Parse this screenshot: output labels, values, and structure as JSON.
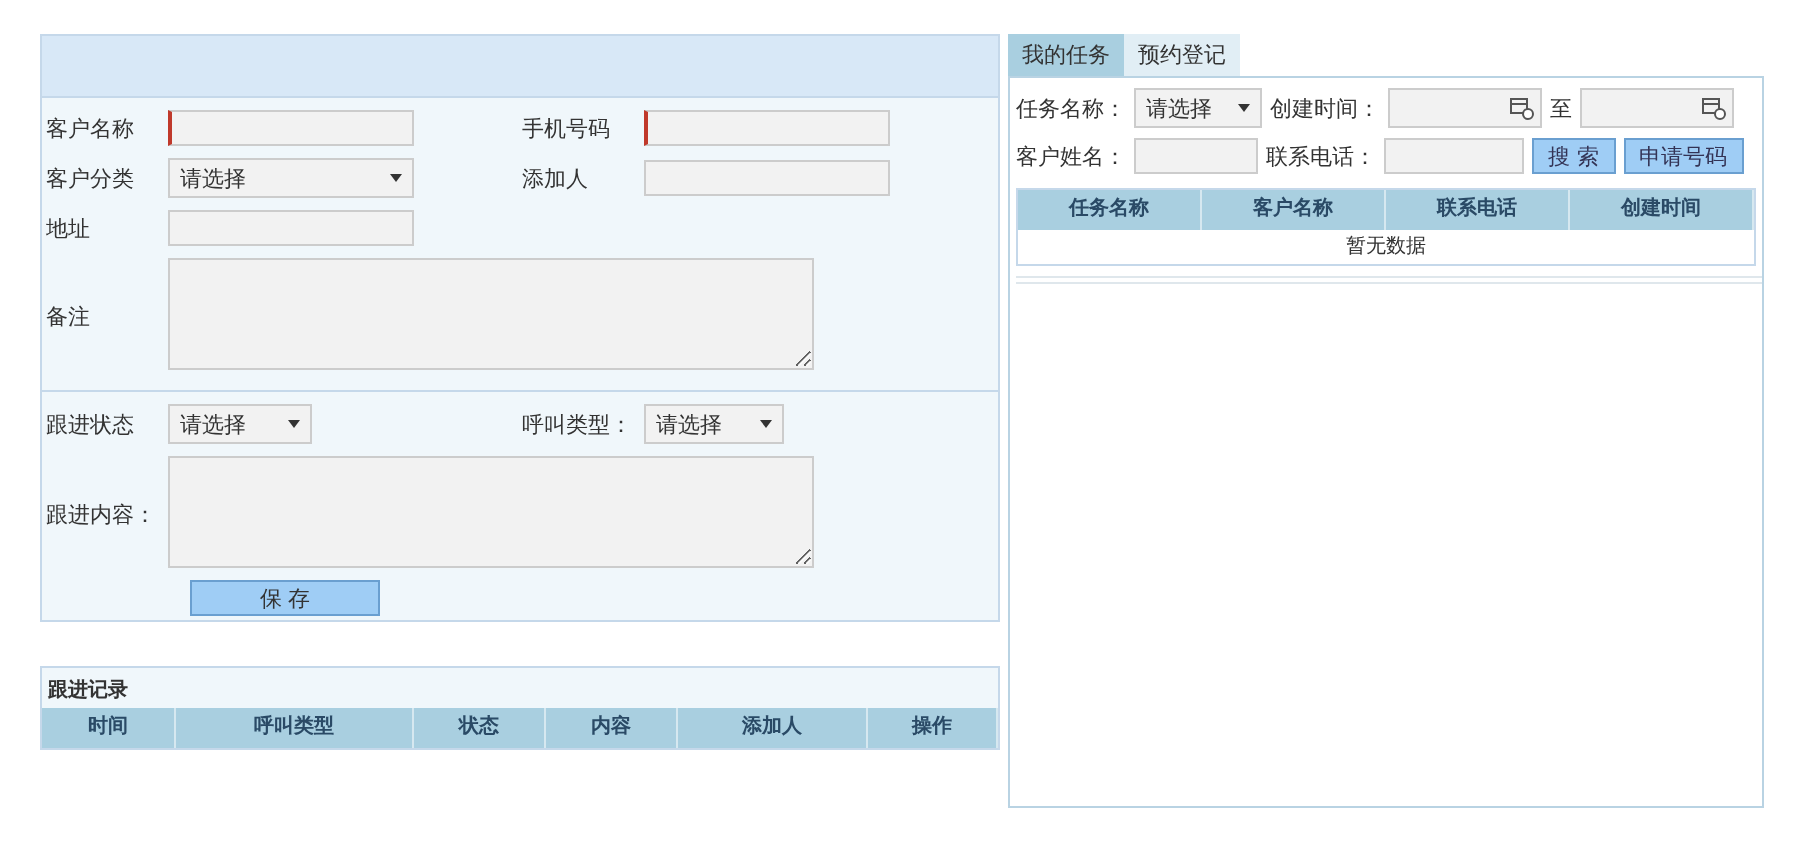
{
  "customer_form": {
    "fields": [
      {
        "label": "客户名称",
        "kind": "input",
        "required": true
      },
      {
        "label": "手机号码",
        "kind": "input",
        "required": true
      },
      {
        "label": "客户分类",
        "kind": "select",
        "value": "请选择"
      },
      {
        "label": "添加人",
        "kind": "input",
        "required": false
      },
      {
        "label": "地址",
        "kind": "input",
        "required": false
      },
      {
        "label": "备注",
        "kind": "textarea"
      }
    ]
  },
  "follow_up_form": {
    "status": {
      "label": "跟进状态",
      "value": "请选择"
    },
    "call_type": {
      "label": "呼叫类型：",
      "value": "请选择"
    },
    "content": {
      "label": "跟进内容："
    },
    "save_button": "保 存"
  },
  "follow_up_records": {
    "title": "跟进记录",
    "columns": [
      "时间",
      "呼叫类型",
      "状态",
      "内容",
      "添加人",
      "操作"
    ]
  },
  "tabs": [
    {
      "label": "我的任务",
      "selected": true
    },
    {
      "label": "预约登记",
      "selected": false
    }
  ],
  "task_filters": {
    "task_name": {
      "label": "任务名称：",
      "value": "请选择"
    },
    "created_time": {
      "label": "创建时间：",
      "to": "至"
    },
    "customer_name": {
      "label": "客户姓名："
    },
    "phone": {
      "label": "联系电话："
    },
    "search_button": "搜 索",
    "apply_button": "申请号码"
  },
  "task_table": {
    "columns": [
      "任务名称",
      "客户名称",
      "联系电话",
      "创建时间"
    ],
    "empty_text": "暂无数据"
  }
}
